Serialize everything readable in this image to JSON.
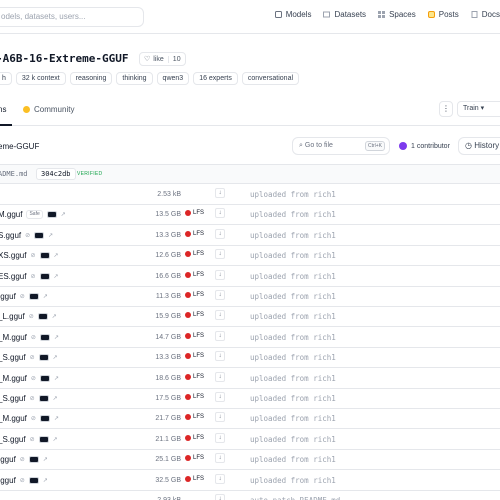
{
  "nav": {
    "search_placeholder": "odels, datasets, users...",
    "links": [
      {
        "label": "Models",
        "icon": "models-icon",
        "color": "#6b7280"
      },
      {
        "label": "Datasets",
        "icon": "datasets-icon",
        "color": "#9ca3af"
      },
      {
        "label": "Spaces",
        "icon": "spaces-icon",
        "color": "#9ca3af"
      },
      {
        "label": "Posts",
        "icon": "posts-icon",
        "color": "#f59e0b"
      },
      {
        "label": "Docs",
        "icon": "docs-icon",
        "color": "#9ca3af"
      }
    ]
  },
  "repo": {
    "title": "-A6B-16-Extreme-GGUF",
    "like_label": "like",
    "like_count": "10",
    "tags": [
      "h",
      "32 k context",
      "reasoning",
      "thinking",
      "qwen3",
      "16 experts",
      "conversational"
    ]
  },
  "tabs": {
    "files": "ns",
    "community": "Community",
    "more": "⋮",
    "train": "Train ▾"
  },
  "pathbar": {
    "name": "eme-GGUF",
    "goto_placeholder": "Go to file",
    "goto_kbd": "Ctrl+K",
    "contributors": "1 contributor",
    "history": "History"
  },
  "commit": {
    "file": "ADME.md",
    "hash": "304c2db",
    "verified": "VERIFIED"
  },
  "files": [
    {
      "name": "",
      "size": "2.53 kB",
      "lfs": false,
      "safe": false,
      "extra": false,
      "message": "uploaded from rich1"
    },
    {
      "name": "M.gguf",
      "size": "13.5 GB",
      "lfs": true,
      "safe": true,
      "safe_label": "Safe",
      "extra": true,
      "message": "uploaded from rich1"
    },
    {
      "name": "S.gguf",
      "size": "13.3 GB",
      "lfs": true,
      "safe": false,
      "extra": true,
      "message": "uploaded from rich1"
    },
    {
      "name": "XS.gguf",
      "size": "12.6 GB",
      "lfs": true,
      "safe": false,
      "extra": true,
      "message": "uploaded from rich1"
    },
    {
      "name": "ES.gguf",
      "size": "16.6 GB",
      "lfs": true,
      "safe": false,
      "extra": true,
      "message": "uploaded from rich1"
    },
    {
      "name": ".gguf",
      "size": "11.3 GB",
      "lfs": true,
      "safe": false,
      "extra": true,
      "message": "uploaded from rich1"
    },
    {
      "name": "_L.gguf",
      "size": "15.9 GB",
      "lfs": true,
      "safe": false,
      "extra": true,
      "message": "uploaded from rich1"
    },
    {
      "name": "_M.gguf",
      "size": "14.7 GB",
      "lfs": true,
      "safe": false,
      "extra": true,
      "message": "uploaded from rich1"
    },
    {
      "name": "_S.gguf",
      "size": "13.3 GB",
      "lfs": true,
      "safe": false,
      "extra": true,
      "message": "uploaded from rich1"
    },
    {
      "name": "_M.gguf",
      "size": "18.6 GB",
      "lfs": true,
      "safe": false,
      "extra": true,
      "message": "uploaded from rich1"
    },
    {
      "name": "_S.gguf",
      "size": "17.5 GB",
      "lfs": true,
      "safe": false,
      "extra": true,
      "message": "uploaded from rich1"
    },
    {
      "name": "_M.gguf",
      "size": "21.7 GB",
      "lfs": true,
      "safe": false,
      "extra": true,
      "message": "uploaded from rich1"
    },
    {
      "name": "_S.gguf",
      "size": "21.1 GB",
      "lfs": true,
      "safe": false,
      "extra": true,
      "message": "uploaded from rich1"
    },
    {
      "name": ".gguf",
      "size": "25.1 GB",
      "lfs": true,
      "safe": false,
      "extra": true,
      "message": "uploaded from rich1"
    },
    {
      "name": ".gguf",
      "size": "32.5 GB",
      "lfs": true,
      "safe": false,
      "extra": true,
      "message": "uploaded from rich1"
    },
    {
      "name": "",
      "size": "2.93 kB",
      "lfs": false,
      "safe": false,
      "extra": false,
      "message": "auto-patch README.md"
    }
  ],
  "colors": {
    "lfs_dot": "#dc2626",
    "verified": "#16a34a",
    "avatar": "#7c3aed",
    "community_dot": "#fbbf24"
  }
}
